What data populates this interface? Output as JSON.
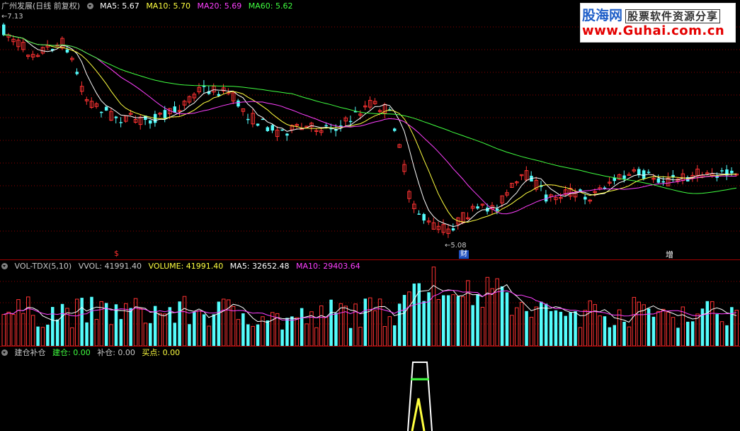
{
  "price_panel": {
    "title": "广州发展(日线 前复权)",
    "ma_items": [
      {
        "label": "MA5: 5.67",
        "color": "#ffffff"
      },
      {
        "label": "MA10: 5.70",
        "color": "#ffff40"
      },
      {
        "label": "MA20: 5.69",
        "color": "#ff40ff"
      },
      {
        "label": "MA60: 5.62",
        "color": "#40ff40"
      }
    ],
    "high_label": "7.13",
    "low_label": "5.08",
    "markers": {
      "left": "$",
      "middle": "财",
      "right": "增"
    }
  },
  "volume_panel": {
    "title": "VOL-TDX(5,10)",
    "items": [
      {
        "label": "VVOL: 41991.40",
        "color": "#c8c8c8"
      },
      {
        "label": "VOLUME: 41991.40",
        "color": "#ffff40"
      },
      {
        "label": "MA5: 32652.48",
        "color": "#ffffff"
      },
      {
        "label": "MA10: 29403.64",
        "color": "#ff40ff"
      }
    ]
  },
  "indicator_panel": {
    "title": "建仓补仓",
    "items": [
      {
        "label": "建仓: 0.00",
        "color": "#40ff40"
      },
      {
        "label": "补仓: 0.00",
        "color": "#c8c8c8"
      },
      {
        "label": "买点: 0.00",
        "color": "#ffff40"
      }
    ]
  },
  "logo": {
    "brand": "股海网",
    "tagline": "股票软件资源分享",
    "url": "www.Guhai.com.cn"
  },
  "colors": {
    "up": "#ff3232",
    "down": "#54fcfc",
    "grid": "#8b0000"
  }
}
